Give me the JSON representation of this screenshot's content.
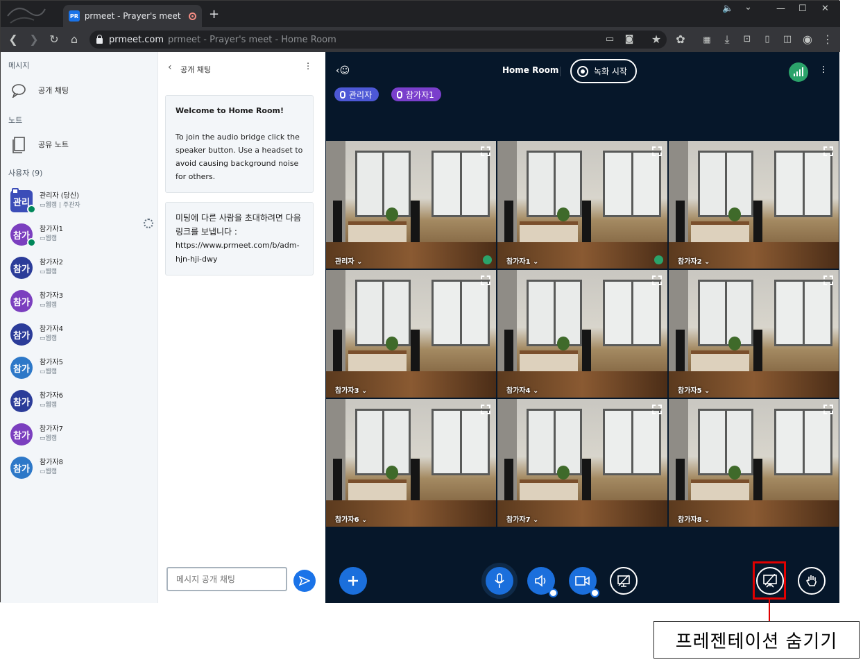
{
  "browser": {
    "tab_title": "prmeet - Prayer's meet - Home Room",
    "favicon_text": "PR",
    "url_host": "prmeet.com",
    "url_title": "prmeet - Prayer's meet - Home Room"
  },
  "sidebar": {
    "messages_heading": "메시지",
    "public_chat_label": "공개 채팅",
    "notes_heading": "노트",
    "shared_notes_label": "공유 노트",
    "users_heading": "사용자 (9)",
    "users": [
      {
        "avatar": "관리",
        "name": "관리자 (당신)",
        "sub": "웹캠 | 주관자",
        "color": "#3b4db8"
      },
      {
        "avatar": "참가",
        "name": "참가자1",
        "sub": "웹캠",
        "color": "#7b3fbf"
      },
      {
        "avatar": "참가",
        "name": "참가자2",
        "sub": "웹캠",
        "color": "#2b3c99"
      },
      {
        "avatar": "참가",
        "name": "참가자3",
        "sub": "웹캠",
        "color": "#7b3fbf"
      },
      {
        "avatar": "참가",
        "name": "참가자4",
        "sub": "웹캠",
        "color": "#2b3c99"
      },
      {
        "avatar": "참가",
        "name": "참가자5",
        "sub": "웹캠",
        "color": "#2d78c8"
      },
      {
        "avatar": "참가",
        "name": "참가자6",
        "sub": "웹캠",
        "color": "#2b3c99"
      },
      {
        "avatar": "참가",
        "name": "참가자7",
        "sub": "웹캠",
        "color": "#7b3fbf"
      },
      {
        "avatar": "참가",
        "name": "참가자8",
        "sub": "웹캠",
        "color": "#2d78c8"
      }
    ]
  },
  "chat": {
    "title": "공개 채팅",
    "welcome_title": "Welcome to Home Room!",
    "welcome_body": "To join the audio bridge click the speaker button. Use a headset to avoid causing background noise for others.",
    "invite_message": "미팅에 다른 사람을 초대하려면 다음 링크를 보냅니다 :",
    "invite_link": "https://www.prmeet.com/b/adm-hjn-hji-dwy",
    "input_placeholder": "메시지 공개 채팅"
  },
  "meeting": {
    "room_title": "Home Room",
    "record_label": "녹화 시작",
    "talking": [
      "관리자",
      "참가자1"
    ],
    "tiles": [
      "관리자",
      "참가자1",
      "참가자2",
      "참가자3",
      "참가자4",
      "참가자5",
      "참가자6",
      "참가자7",
      "참가자8"
    ]
  },
  "annotation": {
    "label": "프레젠테이션 숨기기"
  }
}
